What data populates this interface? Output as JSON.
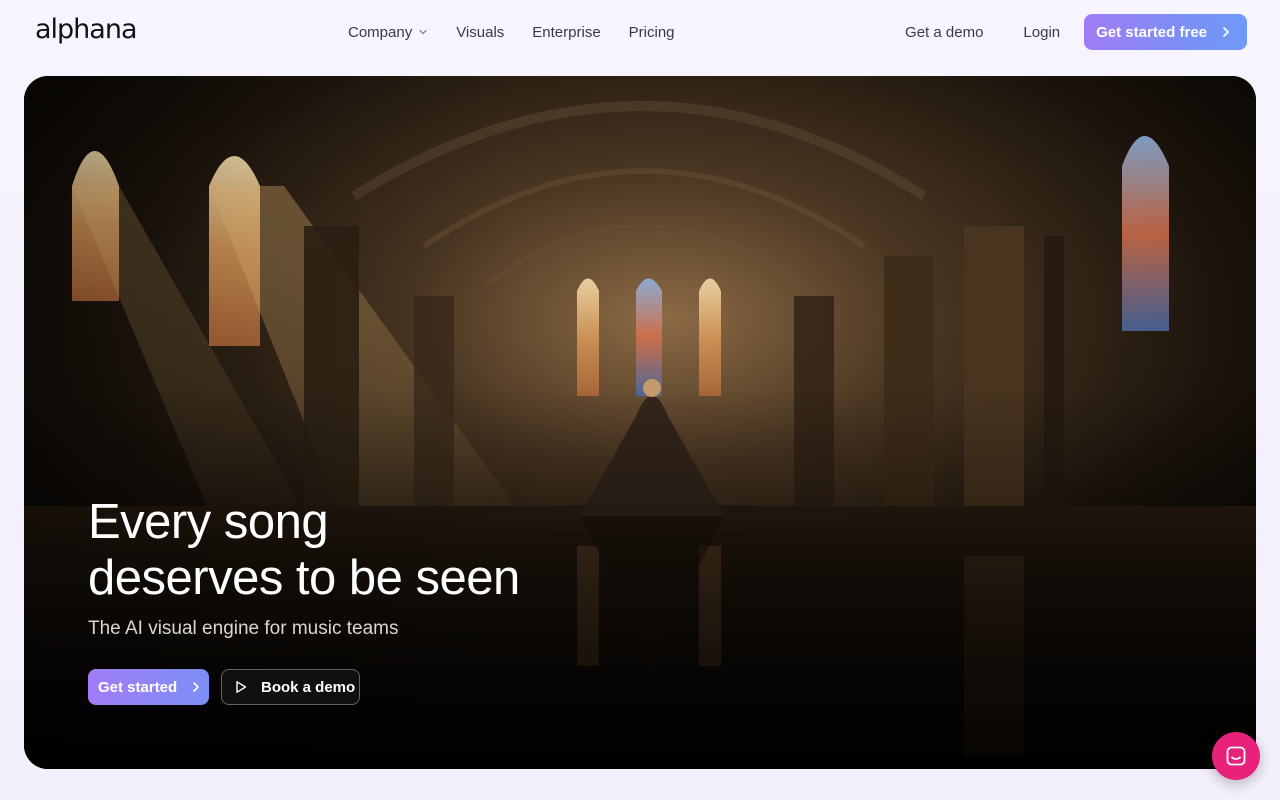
{
  "brand": {
    "logo_text": "alphana"
  },
  "nav": {
    "items": [
      {
        "label": "Company",
        "has_dropdown": true
      },
      {
        "label": "Visuals"
      },
      {
        "label": "Enterprise"
      },
      {
        "label": "Pricing"
      }
    ],
    "get_demo": "Get a demo",
    "login": "Login",
    "cta": "Get started free"
  },
  "hero": {
    "title_line1": "Every song",
    "title_line2": "deserves to be seen",
    "subtitle": "The AI visual engine for music teams",
    "primary_button": "Get started",
    "secondary_button": "Book a demo"
  },
  "colors": {
    "accent_gradient_start": "#a07cf6",
    "accent_gradient_end": "#6f9af7",
    "chat_launcher": "#e8227a"
  },
  "icons": {
    "dropdown": "chevron-down-icon",
    "cta_arrow": "chevron-right-icon",
    "play": "play-icon",
    "chat": "chat-icon"
  }
}
